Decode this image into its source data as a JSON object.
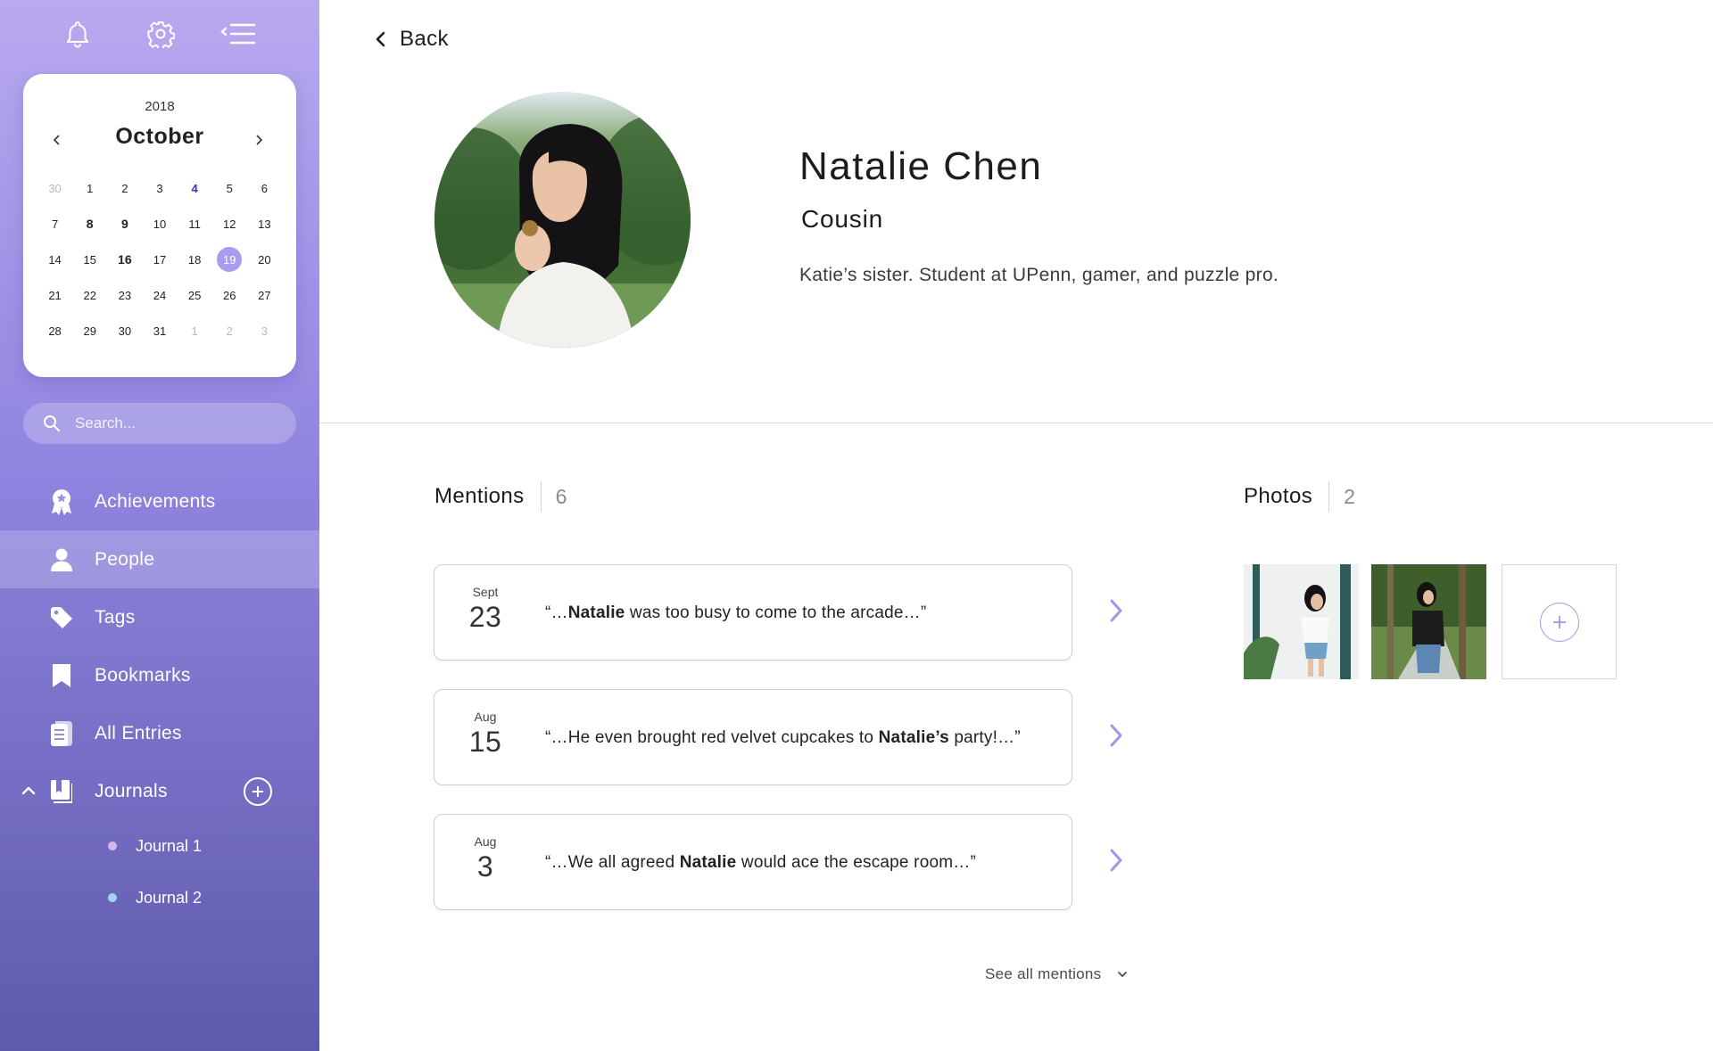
{
  "sidebar": {
    "calendar": {
      "year": "2018",
      "month": "October",
      "days": [
        {
          "d": "30",
          "s": "muted"
        },
        {
          "d": "1",
          "s": ""
        },
        {
          "d": "2",
          "s": ""
        },
        {
          "d": "3",
          "s": ""
        },
        {
          "d": "4",
          "s": "accent"
        },
        {
          "d": "5",
          "s": ""
        },
        {
          "d": "6",
          "s": ""
        },
        {
          "d": "7",
          "s": ""
        },
        {
          "d": "8",
          "s": "bold"
        },
        {
          "d": "9",
          "s": "bold"
        },
        {
          "d": "10",
          "s": ""
        },
        {
          "d": "11",
          "s": ""
        },
        {
          "d": "12",
          "s": ""
        },
        {
          "d": "13",
          "s": ""
        },
        {
          "d": "14",
          "s": ""
        },
        {
          "d": "15",
          "s": ""
        },
        {
          "d": "16",
          "s": "bold"
        },
        {
          "d": "17",
          "s": ""
        },
        {
          "d": "18",
          "s": ""
        },
        {
          "d": "19",
          "s": "selected"
        },
        {
          "d": "20",
          "s": ""
        },
        {
          "d": "21",
          "s": ""
        },
        {
          "d": "22",
          "s": ""
        },
        {
          "d": "23",
          "s": ""
        },
        {
          "d": "24",
          "s": ""
        },
        {
          "d": "25",
          "s": ""
        },
        {
          "d": "26",
          "s": ""
        },
        {
          "d": "27",
          "s": ""
        },
        {
          "d": "28",
          "s": ""
        },
        {
          "d": "29",
          "s": ""
        },
        {
          "d": "30",
          "s": ""
        },
        {
          "d": "31",
          "s": ""
        },
        {
          "d": "1",
          "s": "muted"
        },
        {
          "d": "2",
          "s": "muted"
        },
        {
          "d": "3",
          "s": "muted"
        }
      ]
    },
    "search": {
      "placeholder": "Search..."
    },
    "nav": [
      {
        "label": "Achievements",
        "icon": "award-icon"
      },
      {
        "label": "People",
        "icon": "person-icon",
        "active": true
      },
      {
        "label": "Tags",
        "icon": "tag-icon"
      },
      {
        "label": "Bookmarks",
        "icon": "bookmark-icon"
      },
      {
        "label": "All Entries",
        "icon": "entries-icon"
      },
      {
        "label": "Journals",
        "icon": "journal-icon"
      }
    ],
    "journals": [
      {
        "label": "Journal 1",
        "color": "#d6b8ec"
      },
      {
        "label": "Journal 2",
        "color": "#9fd6f2"
      }
    ]
  },
  "profile": {
    "back_label": "Back",
    "name": "Natalie Chen",
    "relation": "Cousin",
    "bio": "Katie’s sister. Student at UPenn, gamer, and puzzle pro."
  },
  "mentions": {
    "title": "Mentions",
    "count": "6",
    "items": [
      {
        "month": "Sept",
        "day": "23",
        "pre": "“…",
        "bold": "Natalie",
        "post": " was too busy to come to the arcade…”"
      },
      {
        "month": "Aug",
        "day": "15",
        "pre": "“…He even brought red velvet cupcakes to ",
        "bold": "Natalie’s",
        "post": " party!…”"
      },
      {
        "month": "Aug",
        "day": "3",
        "pre": "“…We all agreed ",
        "bold": "Natalie",
        "post": " would ace the escape room…”"
      }
    ],
    "see_all_label": "See all mentions"
  },
  "photos": {
    "title": "Photos",
    "count": "2"
  },
  "colors": {
    "accent": "#a295ea",
    "sidebar_top": "#b9a9f0",
    "sidebar_bottom": "#5e5aab"
  }
}
